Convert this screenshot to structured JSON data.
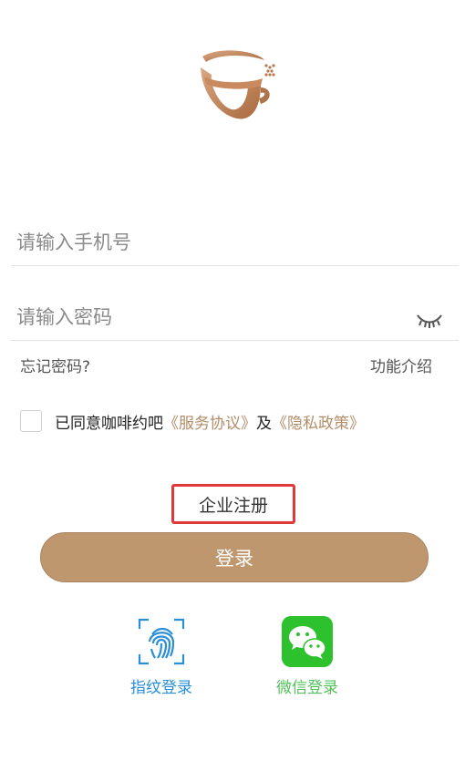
{
  "login": {
    "phone_placeholder": "请输入手机号",
    "password_placeholder": "请输入密码",
    "forgot_password": "忘记密码?",
    "features": "功能介绍",
    "agree_prefix": "已同意咖啡约吧",
    "service_agreement": "《服务协议》",
    "and": "及",
    "privacy_policy": "《隐私政策》",
    "enterprise_register": "企业注册",
    "login_button": "登录",
    "fingerprint_login": "指纹登录",
    "wechat_login": "微信登录"
  },
  "colors": {
    "accent": "#bf976f",
    "link": "#b28d69",
    "fingerprint": "#2a8fd6",
    "wechat": "#52c15a",
    "highlight": "#e0393a"
  },
  "icons": [
    "coffee-cup-logo",
    "eye-closed-icon",
    "fingerprint-icon",
    "wechat-icon"
  ]
}
